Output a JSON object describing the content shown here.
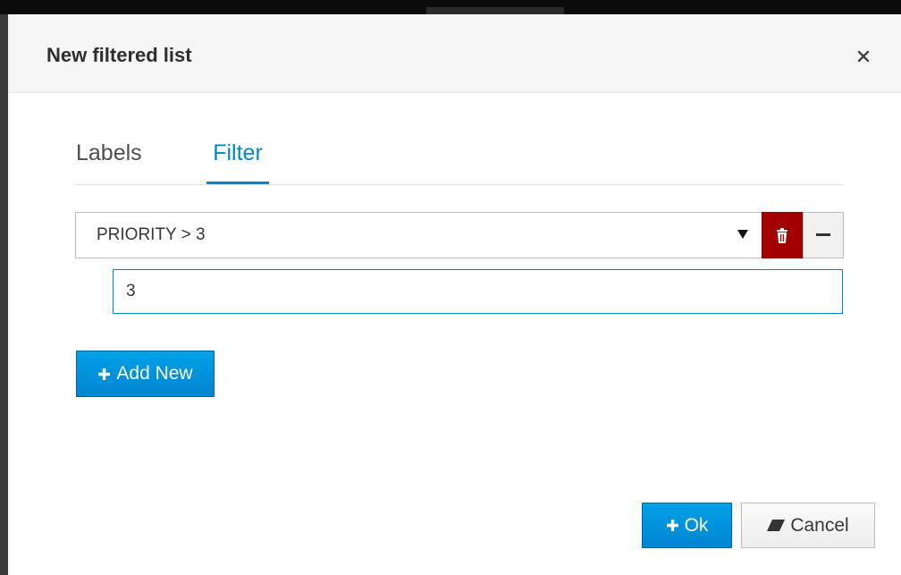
{
  "dialog": {
    "title": "New filtered list",
    "close_icon": "close-icon"
  },
  "tabs": [
    {
      "label": "Labels",
      "active": false
    },
    {
      "label": "Filter",
      "active": true
    }
  ],
  "filter": {
    "selected": "PRIORITY > 3",
    "value": "3",
    "delete_icon": "trash-icon",
    "collapse_icon": "minus-icon"
  },
  "actions": {
    "add_new_label": "Add New",
    "ok_label": "Ok",
    "cancel_label": "Cancel"
  },
  "colors": {
    "accent": "#0088ce",
    "danger": "#a30000",
    "header_bg": "#f5f5f5"
  }
}
